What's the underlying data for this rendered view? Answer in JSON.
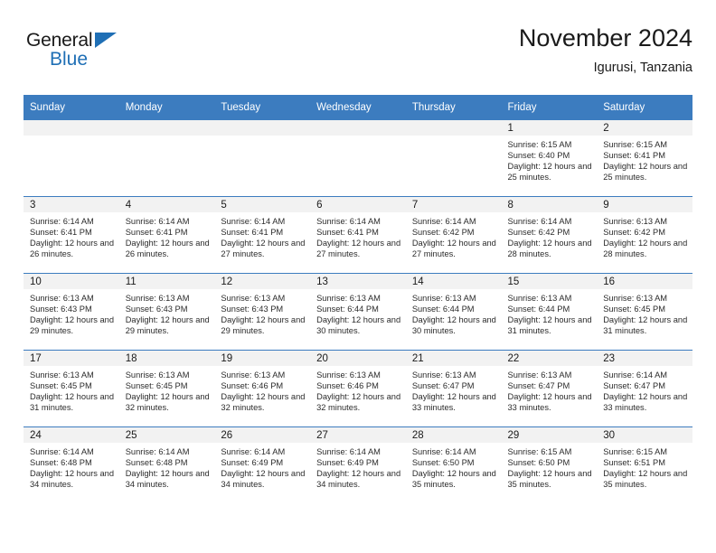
{
  "brand": {
    "line1": "General",
    "line2": "Blue",
    "flag_icon": "brand-triangle-icon",
    "accent_color": "#1f6fb5"
  },
  "header": {
    "title": "November 2024",
    "subtitle": "Igurusi, Tanzania"
  },
  "theme": {
    "header_blue": "#3c7cbf",
    "day_band_gray": "#f2f2f2",
    "text": "#1a1a1a"
  },
  "weekdays": [
    "Sunday",
    "Monday",
    "Tuesday",
    "Wednesday",
    "Thursday",
    "Friday",
    "Saturday"
  ],
  "labels": {
    "sunrise_prefix": "Sunrise:",
    "sunset_prefix": "Sunset:",
    "daylight_prefix": "Daylight:"
  },
  "weeks": [
    [
      {
        "day": "",
        "empty": true
      },
      {
        "day": "",
        "empty": true
      },
      {
        "day": "",
        "empty": true
      },
      {
        "day": "",
        "empty": true
      },
      {
        "day": "",
        "empty": true
      },
      {
        "day": "1",
        "sunrise": "Sunrise: 6:15 AM",
        "sunset": "Sunset: 6:40 PM",
        "daylight": "Daylight: 12 hours and 25 minutes."
      },
      {
        "day": "2",
        "sunrise": "Sunrise: 6:15 AM",
        "sunset": "Sunset: 6:41 PM",
        "daylight": "Daylight: 12 hours and 25 minutes."
      }
    ],
    [
      {
        "day": "3",
        "sunrise": "Sunrise: 6:14 AM",
        "sunset": "Sunset: 6:41 PM",
        "daylight": "Daylight: 12 hours and 26 minutes."
      },
      {
        "day": "4",
        "sunrise": "Sunrise: 6:14 AM",
        "sunset": "Sunset: 6:41 PM",
        "daylight": "Daylight: 12 hours and 26 minutes."
      },
      {
        "day": "5",
        "sunrise": "Sunrise: 6:14 AM",
        "sunset": "Sunset: 6:41 PM",
        "daylight": "Daylight: 12 hours and 27 minutes."
      },
      {
        "day": "6",
        "sunrise": "Sunrise: 6:14 AM",
        "sunset": "Sunset: 6:41 PM",
        "daylight": "Daylight: 12 hours and 27 minutes."
      },
      {
        "day": "7",
        "sunrise": "Sunrise: 6:14 AM",
        "sunset": "Sunset: 6:42 PM",
        "daylight": "Daylight: 12 hours and 27 minutes."
      },
      {
        "day": "8",
        "sunrise": "Sunrise: 6:14 AM",
        "sunset": "Sunset: 6:42 PM",
        "daylight": "Daylight: 12 hours and 28 minutes."
      },
      {
        "day": "9",
        "sunrise": "Sunrise: 6:13 AM",
        "sunset": "Sunset: 6:42 PM",
        "daylight": "Daylight: 12 hours and 28 minutes."
      }
    ],
    [
      {
        "day": "10",
        "sunrise": "Sunrise: 6:13 AM",
        "sunset": "Sunset: 6:43 PM",
        "daylight": "Daylight: 12 hours and 29 minutes."
      },
      {
        "day": "11",
        "sunrise": "Sunrise: 6:13 AM",
        "sunset": "Sunset: 6:43 PM",
        "daylight": "Daylight: 12 hours and 29 minutes."
      },
      {
        "day": "12",
        "sunrise": "Sunrise: 6:13 AM",
        "sunset": "Sunset: 6:43 PM",
        "daylight": "Daylight: 12 hours and 29 minutes."
      },
      {
        "day": "13",
        "sunrise": "Sunrise: 6:13 AM",
        "sunset": "Sunset: 6:44 PM",
        "daylight": "Daylight: 12 hours and 30 minutes."
      },
      {
        "day": "14",
        "sunrise": "Sunrise: 6:13 AM",
        "sunset": "Sunset: 6:44 PM",
        "daylight": "Daylight: 12 hours and 30 minutes."
      },
      {
        "day": "15",
        "sunrise": "Sunrise: 6:13 AM",
        "sunset": "Sunset: 6:44 PM",
        "daylight": "Daylight: 12 hours and 31 minutes."
      },
      {
        "day": "16",
        "sunrise": "Sunrise: 6:13 AM",
        "sunset": "Sunset: 6:45 PM",
        "daylight": "Daylight: 12 hours and 31 minutes."
      }
    ],
    [
      {
        "day": "17",
        "sunrise": "Sunrise: 6:13 AM",
        "sunset": "Sunset: 6:45 PM",
        "daylight": "Daylight: 12 hours and 31 minutes."
      },
      {
        "day": "18",
        "sunrise": "Sunrise: 6:13 AM",
        "sunset": "Sunset: 6:45 PM",
        "daylight": "Daylight: 12 hours and 32 minutes."
      },
      {
        "day": "19",
        "sunrise": "Sunrise: 6:13 AM",
        "sunset": "Sunset: 6:46 PM",
        "daylight": "Daylight: 12 hours and 32 minutes."
      },
      {
        "day": "20",
        "sunrise": "Sunrise: 6:13 AM",
        "sunset": "Sunset: 6:46 PM",
        "daylight": "Daylight: 12 hours and 32 minutes."
      },
      {
        "day": "21",
        "sunrise": "Sunrise: 6:13 AM",
        "sunset": "Sunset: 6:47 PM",
        "daylight": "Daylight: 12 hours and 33 minutes."
      },
      {
        "day": "22",
        "sunrise": "Sunrise: 6:13 AM",
        "sunset": "Sunset: 6:47 PM",
        "daylight": "Daylight: 12 hours and 33 minutes."
      },
      {
        "day": "23",
        "sunrise": "Sunrise: 6:14 AM",
        "sunset": "Sunset: 6:47 PM",
        "daylight": "Daylight: 12 hours and 33 minutes."
      }
    ],
    [
      {
        "day": "24",
        "sunrise": "Sunrise: 6:14 AM",
        "sunset": "Sunset: 6:48 PM",
        "daylight": "Daylight: 12 hours and 34 minutes."
      },
      {
        "day": "25",
        "sunrise": "Sunrise: 6:14 AM",
        "sunset": "Sunset: 6:48 PM",
        "daylight": "Daylight: 12 hours and 34 minutes."
      },
      {
        "day": "26",
        "sunrise": "Sunrise: 6:14 AM",
        "sunset": "Sunset: 6:49 PM",
        "daylight": "Daylight: 12 hours and 34 minutes."
      },
      {
        "day": "27",
        "sunrise": "Sunrise: 6:14 AM",
        "sunset": "Sunset: 6:49 PM",
        "daylight": "Daylight: 12 hours and 34 minutes."
      },
      {
        "day": "28",
        "sunrise": "Sunrise: 6:14 AM",
        "sunset": "Sunset: 6:50 PM",
        "daylight": "Daylight: 12 hours and 35 minutes."
      },
      {
        "day": "29",
        "sunrise": "Sunrise: 6:15 AM",
        "sunset": "Sunset: 6:50 PM",
        "daylight": "Daylight: 12 hours and 35 minutes."
      },
      {
        "day": "30",
        "sunrise": "Sunrise: 6:15 AM",
        "sunset": "Sunset: 6:51 PM",
        "daylight": "Daylight: 12 hours and 35 minutes."
      }
    ]
  ]
}
